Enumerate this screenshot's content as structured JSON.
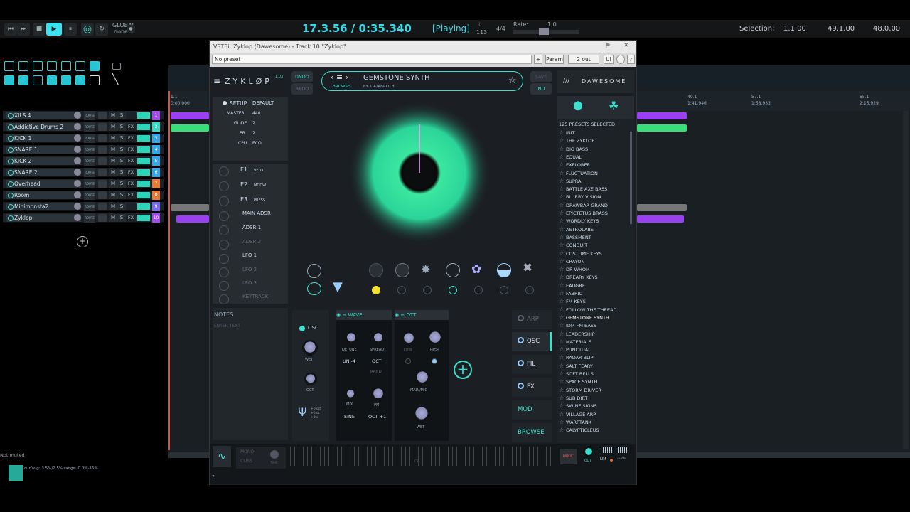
{
  "transport": {
    "time": "17.3.56 / 0:35.340",
    "status": "[Playing]",
    "tempo": "113",
    "tempo_sym": "♩",
    "timesig": "4/4",
    "rate_label": "Rate:",
    "rate_value": "1.0",
    "global_label": "GLOBAL",
    "global_value": "none",
    "selection_label": "Selection:",
    "sel_start": "1.1.00",
    "sel_end": "49.1.00",
    "sel_len": "48.0.00"
  },
  "tracks": [
    {
      "name": "XILS 4",
      "num": "1",
      "color": "#a24cf0",
      "fx": ""
    },
    {
      "name": "Addictive Drums 2",
      "num": "2",
      "color": "#3ed7c2",
      "fx": "FX"
    },
    {
      "name": "KICK 1",
      "num": "3",
      "color": "#37a6e8",
      "fx": "FX"
    },
    {
      "name": "SNARE 1",
      "num": "4",
      "color": "#37a6e8",
      "fx": "FX"
    },
    {
      "name": "KICK 2",
      "num": "5",
      "color": "#37a6e8",
      "fx": "FX"
    },
    {
      "name": "SNARE 2",
      "num": "6",
      "color": "#37a6e8",
      "fx": "FX"
    },
    {
      "name": "Overhead",
      "num": "7",
      "color": "#e77a3b",
      "fx": "FX"
    },
    {
      "name": "Room",
      "num": "8",
      "color": "#e77a3b",
      "fx": "FX"
    },
    {
      "name": "Minimonsta2",
      "num": "9",
      "color": "#7a6cf0",
      "fx": ""
    },
    {
      "name": "Zyklop",
      "num": "10",
      "color": "#a24cf0",
      "fx": "FX"
    }
  ],
  "track_labels": {
    "route": "ROUTE",
    "mute": "M",
    "solo": "S",
    "add": "+"
  },
  "status": {
    "not_muted": "Not muted",
    "cpu": "cur/avg: 3.5%/2.5%  range: 0.0%-15%"
  },
  "ruler": {
    "r1": "1.1",
    "r1t": "0:00.000",
    "r49": "49.1",
    "r49t": "1:41.946",
    "r57": "57.1",
    "r57t": "1:58.933",
    "r65": "65.1",
    "r65t": "2:15.929"
  },
  "plugin": {
    "title": "VST3i: Zyklop (Dawesome) - Track 10 \"Zyklop\"",
    "preset_select": "No preset",
    "plus": "+",
    "param": "Param",
    "out": "2 out",
    "ui": "UI",
    "logo": "ZYKLØP",
    "version": "1.03",
    "undo": "UNDO",
    "redo": "REDO",
    "save": "SAVE",
    "init": "INIT",
    "preset_name": "GEMSTONE SYNTH",
    "browse_label": "BROWSE",
    "by_label": "BY",
    "author": "DATABROTH",
    "brand": "DAWESOME",
    "setup": {
      "setup": "SETUP",
      "setup_val": "DEFAULT",
      "master": "MASTER",
      "master_val": "440",
      "glide": "GLIDE",
      "glide_val": "2",
      "pb": "PB",
      "pb_val": "2",
      "cpu": "CPU",
      "cpu_val": "ECO"
    },
    "mods": [
      {
        "name": "E1",
        "sub": "VELO"
      },
      {
        "name": "E2",
        "sub": "MODW"
      },
      {
        "name": "E3",
        "sub": "PRESS"
      }
    ],
    "mods2": [
      "MAIN ADSR",
      "ADSR 1",
      "ADSR 2",
      "LFO 1",
      "LFO 2",
      "LFO 3",
      "KEYTRACK"
    ],
    "notes_title": "NOTES",
    "notes_placeholder": "ENTER TEXT",
    "osc": {
      "title": "OSC",
      "wet": "WET",
      "oct": "OCT",
      "oct_vals": "+0 oct\n+0 ct\n+0 c"
    },
    "wave": {
      "title": "WAVE",
      "detune": "DETUNE",
      "spread": "SPREAD",
      "uni": "UNI-4",
      "octv": "OCT",
      "rand": "RAND",
      "mix": "MIX",
      "pm": "PM",
      "sine": "SINE",
      "oct1": "OCT +1"
    },
    "ott": {
      "title": "OTT",
      "low": "LOW",
      "high": "HIGH",
      "mainmid": "MAIN/MID",
      "wet": "WET"
    },
    "side": [
      "ARP",
      "OSC",
      "FIL",
      "FX",
      "MOD",
      "BROWSE"
    ],
    "presets_count": "125 PRESETS SELECTED",
    "presets": [
      "INIT",
      "THE ZYKLOP",
      "DIG BASS",
      "EQUAL",
      "EXPLORER",
      "FLUCTUATION",
      "SUPRA",
      "BATTLE AXE BASS",
      "BLURRY VISION",
      "DRAWBAR GRAND",
      "EPICTETUS BRASS",
      "WORDLY KEYS",
      "ASTROLABE",
      "BASSMENT",
      "CONDUIT",
      "COSTUME KEYS",
      "CRAYON",
      "DR WHOM",
      "DREARY KEYS",
      "EAUGRE",
      "FABRIC",
      "FM KEYS",
      "FOLLOW THE THREAD",
      "GEMSTONE SYNTH",
      "IDM FM BASS",
      "LEADERSHIP",
      "MATERIALS",
      "PUNCTUAL",
      "RADAR BLIP",
      "SALT FEARY",
      "SOFT BELLS",
      "SPACE SYNTH",
      "STORM DRIVER",
      "SUB DIRT",
      "SWINE SIGNS",
      "VILLAGE ARP",
      "WARPTANK",
      "CALYPTICLEUS"
    ],
    "bottom": {
      "mono": "MONO",
      "cliss": "CLISS",
      "time": "TIME",
      "panic": "PANIC!",
      "outl": "OUT",
      "lim": "LIM",
      "db": "-6 dB",
      "kb": "C3",
      "q": "?"
    }
  }
}
